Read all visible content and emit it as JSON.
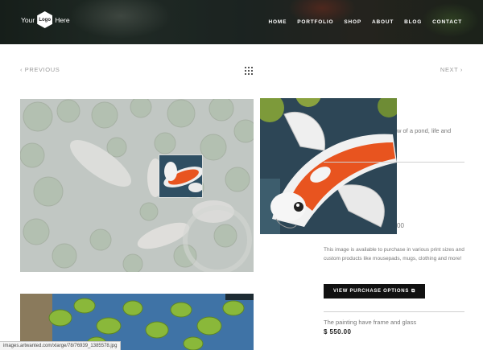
{
  "header": {
    "logo": {
      "left_text": "Your",
      "center_text": "Logo",
      "right_text": "Here"
    },
    "nav": [
      "HOME",
      "PORTFOLIO",
      "SHOP",
      "ABOUT",
      "BLOG",
      "CONTACT"
    ]
  },
  "pager": {
    "previous_label": "PREVIOUS",
    "next_label": "NEXT",
    "prev_icon": "chevron-left-icon",
    "next_icon": "chevron-right-icon",
    "grid_icon": "grid-icon"
  },
  "artwork": {
    "subject": "koi pond painting",
    "zoom_icon": "magnifier-lens"
  },
  "sidebar": {
    "description_partial": "w of a pond, life and",
    "price_partial": "00",
    "info_text": "This image is available to purchase in various print sizes and custom products like mousepads, mugs, clothing and more!",
    "buy_button_label": "VIEW PURCHASE OPTIONS",
    "buy_button_icon": "external-link-icon",
    "frame_text": "The painting have frame and glass",
    "price": "$ 550.00"
  },
  "status_bar": {
    "url": "images.artwanted.com/xlarge/78/76939_1385578.jpg"
  },
  "colors": {
    "accent": "#111111",
    "header_bg": "#26312e",
    "text": "#777777",
    "koi_orange": "#e8541f"
  }
}
